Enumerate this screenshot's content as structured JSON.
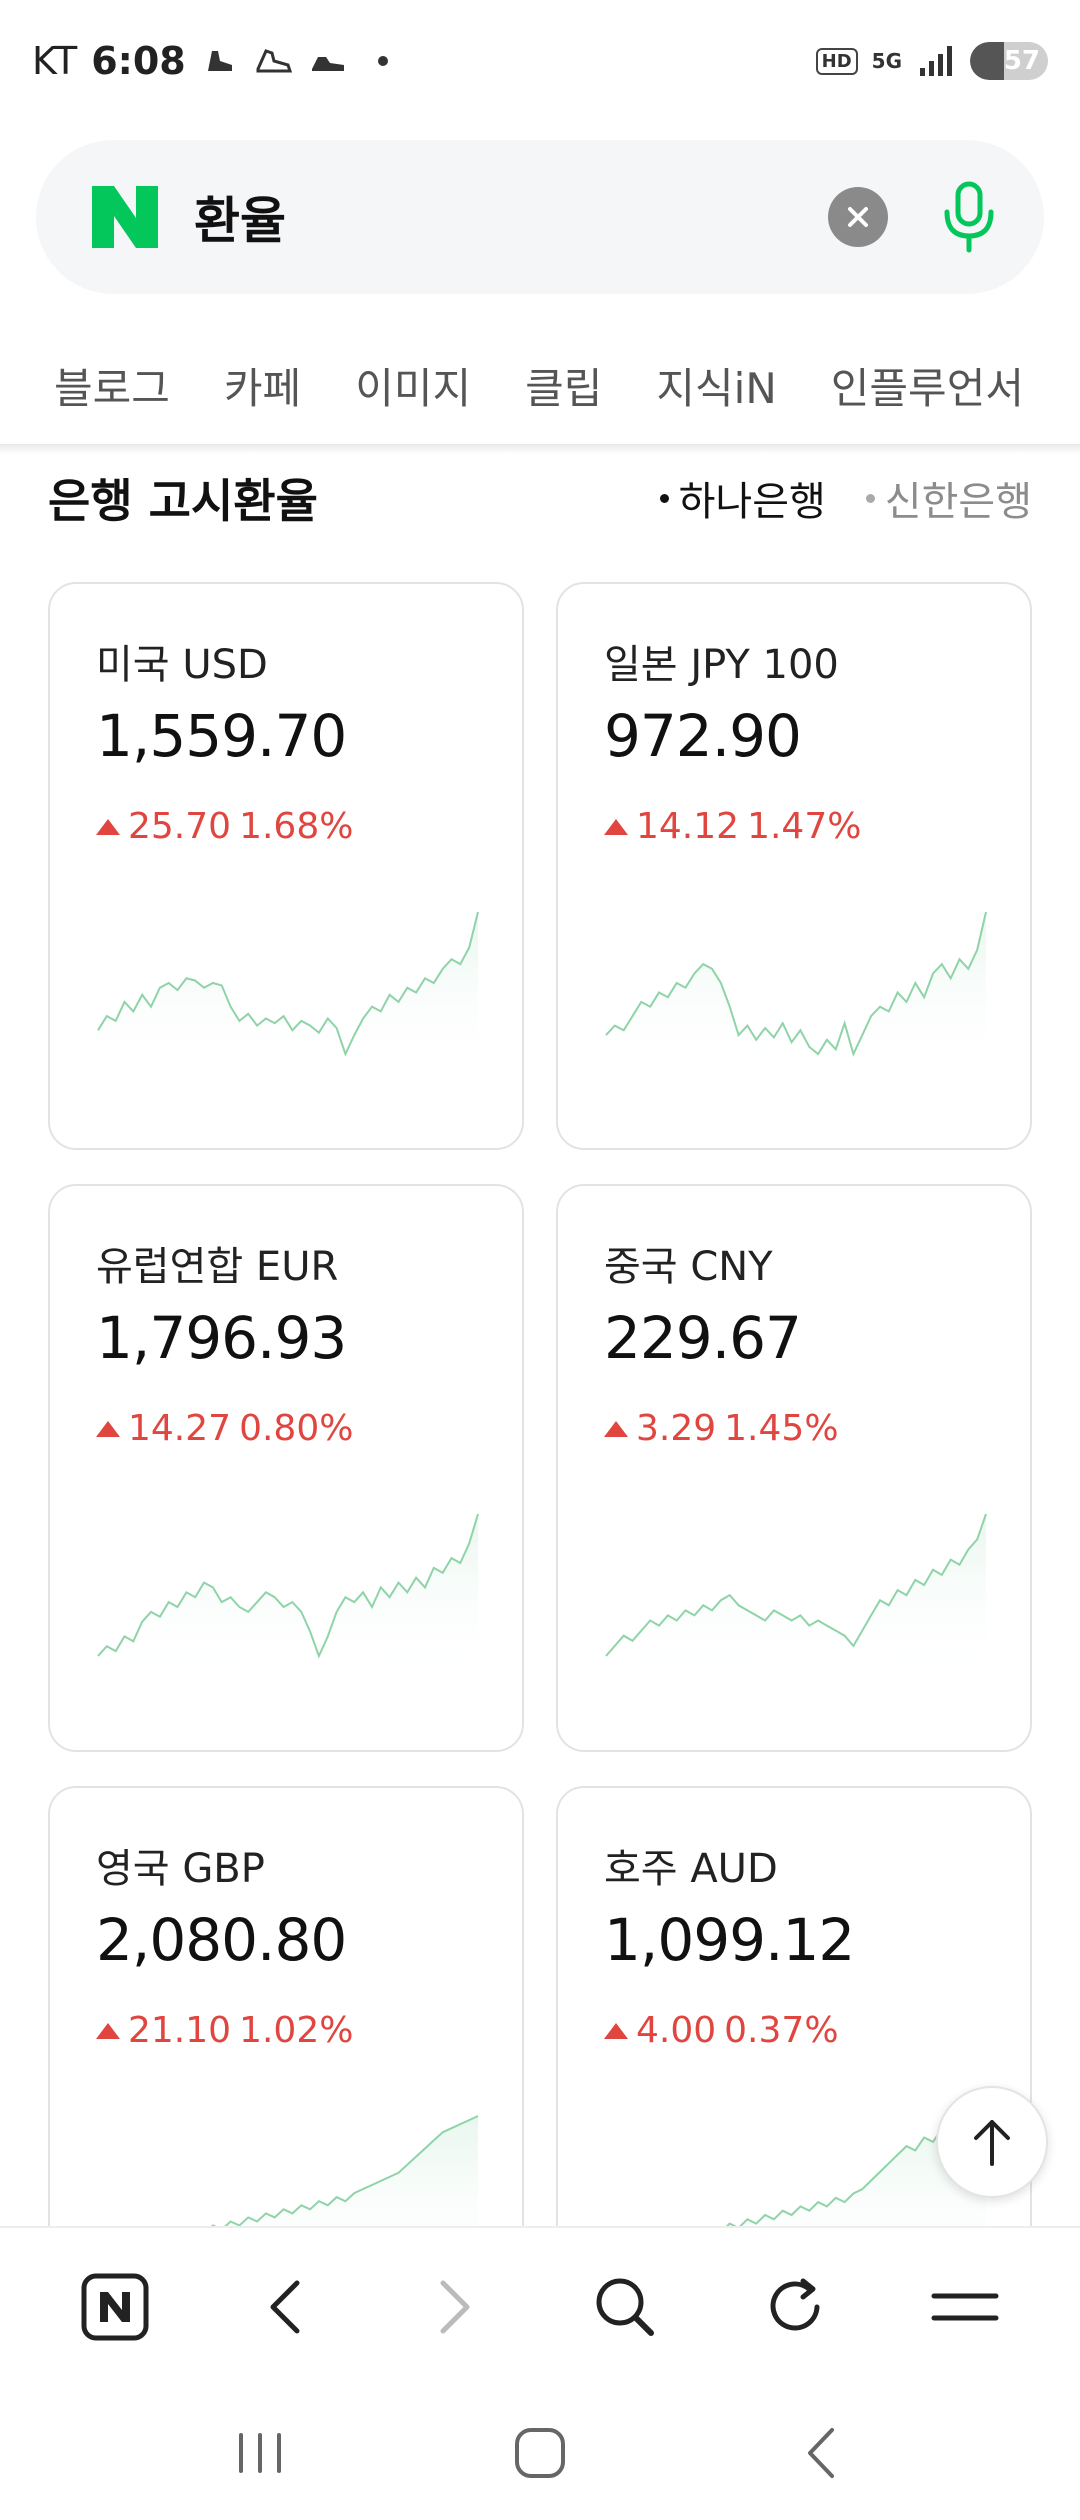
{
  "status_bar": {
    "carrier": "KT",
    "time": "6:08",
    "hd_label": "HD",
    "network_label": "5G",
    "battery_level": "57",
    "icons": [
      "shoe-icon",
      "sneaker-icon",
      "sneaker-icon",
      "signal-icon"
    ]
  },
  "search": {
    "query": "환율",
    "logo": "naver-n-logo",
    "accent": "#03c75a"
  },
  "tabs": [
    {
      "label": "블로그"
    },
    {
      "label": "카페"
    },
    {
      "label": "이미지"
    },
    {
      "label": "클립"
    },
    {
      "label": "지식iN"
    },
    {
      "label": "인플루언서"
    }
  ],
  "section": {
    "title": "은행 고시환율",
    "banks": [
      {
        "label": "하나은행",
        "active": true
      },
      {
        "label": "신한은행",
        "active": false
      }
    ]
  },
  "colors": {
    "up": "#e0463f",
    "spark_line": "#8fd3a8",
    "spark_fill": "#e8f6ee"
  },
  "cards": [
    {
      "name": "미국 USD",
      "rate": "1,559.70",
      "change": "25.70",
      "percent": "1.68%",
      "trend": [
        40,
        46,
        44,
        52,
        48,
        55,
        50,
        58,
        60,
        57,
        62,
        61,
        58,
        60,
        59,
        50,
        44,
        47,
        42,
        45,
        43,
        46,
        40,
        44,
        42,
        39,
        45,
        41,
        30,
        38,
        45,
        50,
        48,
        55,
        52,
        58,
        56,
        62,
        60,
        66,
        70,
        68,
        75,
        90
      ]
    },
    {
      "name": "일본 JPY 100",
      "rate": "972.90",
      "change": "14.12",
      "percent": "1.47%",
      "trend": [
        30,
        34,
        32,
        38,
        44,
        42,
        48,
        46,
        52,
        50,
        56,
        60,
        58,
        52,
        42,
        30,
        34,
        28,
        33,
        29,
        35,
        27,
        32,
        25,
        22,
        28,
        24,
        35,
        22,
        30,
        38,
        42,
        40,
        48,
        44,
        52,
        46,
        56,
        60,
        54,
        62,
        58,
        66,
        82
      ]
    },
    {
      "name": "유럽연합 EUR",
      "rate": "1,796.93",
      "change": "14.27",
      "percent": "0.80%",
      "trend": [
        30,
        34,
        32,
        38,
        36,
        44,
        48,
        46,
        52,
        50,
        56,
        54,
        60,
        58,
        52,
        54,
        50,
        48,
        52,
        56,
        54,
        50,
        52,
        48,
        40,
        30,
        38,
        48,
        54,
        52,
        56,
        50,
        58,
        54,
        60,
        56,
        62,
        58,
        66,
        64,
        70,
        68,
        76,
        88
      ]
    },
    {
      "name": "중국 CNY",
      "rate": "229.67",
      "change": "3.29",
      "percent": "1.45%",
      "trend": [
        30,
        34,
        38,
        36,
        40,
        44,
        42,
        46,
        44,
        48,
        46,
        50,
        48,
        52,
        54,
        50,
        48,
        46,
        44,
        48,
        46,
        44,
        46,
        42,
        44,
        42,
        40,
        38,
        34,
        40,
        46,
        52,
        50,
        56,
        54,
        60,
        58,
        64,
        62,
        68,
        66,
        72,
        76,
        86
      ]
    },
    {
      "name": "영국 GBP",
      "rate": "2,080.80",
      "change": "21.10",
      "percent": "1.02%",
      "trend": [
        20,
        22,
        24,
        26,
        24,
        28,
        26,
        30,
        28,
        32,
        30,
        34,
        32,
        36,
        34,
        38,
        36,
        40,
        38,
        42,
        40,
        44,
        42,
        46,
        44,
        48,
        46,
        50,
        48,
        52,
        54,
        56,
        58,
        60,
        62,
        66,
        70,
        74,
        78,
        82,
        84,
        86,
        88,
        90
      ]
    },
    {
      "name": "호주 AUD",
      "rate": "1,099.12",
      "change": "4.00",
      "percent": "0.37%",
      "trend": [
        20,
        22,
        24,
        22,
        26,
        24,
        28,
        26,
        30,
        28,
        32,
        30,
        34,
        32,
        36,
        34,
        38,
        36,
        40,
        38,
        42,
        40,
        44,
        42,
        46,
        44,
        48,
        46,
        50,
        52,
        56,
        60,
        64,
        68,
        72,
        70,
        76,
        74,
        80,
        78,
        82,
        80,
        84,
        86
      ]
    }
  ]
}
